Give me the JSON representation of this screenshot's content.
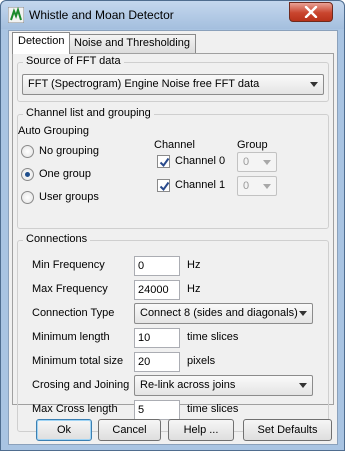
{
  "window": {
    "title": "Whistle and Moan Detector",
    "icon": "app-logo-icon",
    "close_icon": "close-icon"
  },
  "tabs": [
    {
      "label": "Detection",
      "selected": true
    },
    {
      "label": "Noise and Thresholding",
      "selected": false
    }
  ],
  "source": {
    "legend": "Source of FFT data",
    "selected": "FFT (Spectrogram) Engine Noise free FFT data"
  },
  "channels": {
    "legend": "Channel list and grouping",
    "auto_grouping_label": "Auto Grouping",
    "grouping_options": [
      {
        "label": "No grouping",
        "selected": false
      },
      {
        "label": "One group",
        "selected": true
      },
      {
        "label": "User groups",
        "selected": false
      }
    ],
    "channel_header": "Channel",
    "group_header": "Group",
    "rows": [
      {
        "label": "Channel 0",
        "checked": true,
        "group": "0"
      },
      {
        "label": "Channel 1",
        "checked": true,
        "group": "0"
      }
    ]
  },
  "connections": {
    "legend": "Connections",
    "min_frequency": {
      "label": "Min Frequency",
      "value": "0",
      "unit": "Hz"
    },
    "max_frequency": {
      "label": "Max Frequency",
      "value": "24000",
      "unit": "Hz"
    },
    "connection_type": {
      "label": "Connection Type",
      "value": "Connect 8 (sides and diagonals)"
    },
    "min_length": {
      "label": "Minimum length",
      "value": "10",
      "unit": "time slices"
    },
    "min_total_size": {
      "label": "Minimum total size",
      "value": "20",
      "unit": "pixels"
    },
    "crossing": {
      "label": "Crosing and Joining",
      "value": "Re-link across joins"
    },
    "max_cross_length": {
      "label": "Max Cross length",
      "value": "5",
      "unit": "time slices"
    }
  },
  "buttons": {
    "ok": "Ok",
    "cancel": "Cancel",
    "help": "Help ...",
    "set_defaults": "Set Defaults"
  }
}
